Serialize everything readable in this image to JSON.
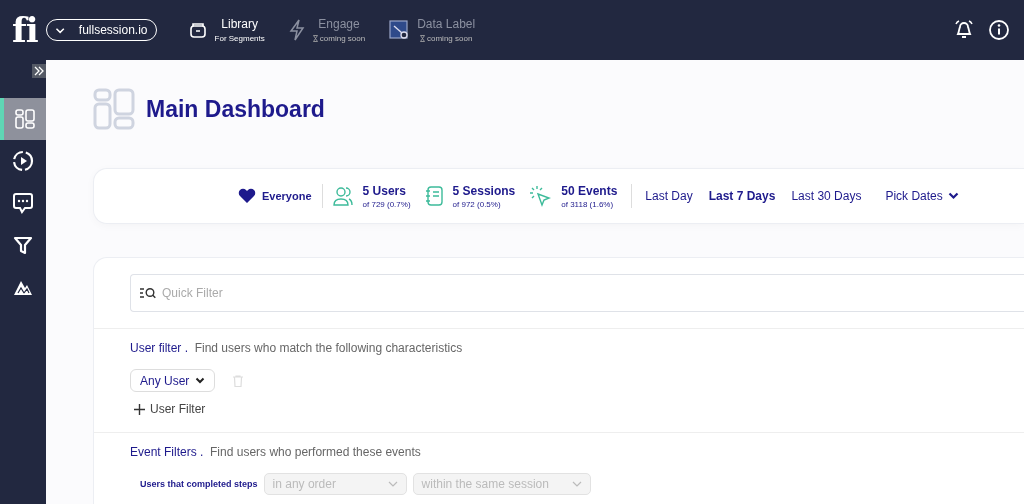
{
  "topbar": {
    "logo": "fi",
    "workspace": "fullsession.io",
    "nav": [
      {
        "kind": "library",
        "label": "Library",
        "sub": "For Segments",
        "disabled": false
      },
      {
        "kind": "engage",
        "label": "Engage",
        "sub": "coming soon",
        "disabled": true
      },
      {
        "kind": "datalabel",
        "label": "Data Label",
        "sub": "coming soon",
        "disabled": true
      }
    ]
  },
  "sidebar": {
    "items": [
      {
        "kind": "dashboard",
        "selected": true
      },
      {
        "kind": "replay",
        "selected": false
      },
      {
        "kind": "chat",
        "selected": false
      },
      {
        "kind": "funnel",
        "selected": false
      },
      {
        "kind": "mountain",
        "selected": false
      }
    ]
  },
  "page": {
    "title": "Main Dashboard"
  },
  "stats": {
    "segment": "Everyone",
    "items": [
      {
        "kind": "users",
        "value": "5 Users",
        "sub": "of 729 (0.7%)"
      },
      {
        "kind": "sessions",
        "value": "5 Sessions",
        "sub": "of 972 (0.5%)"
      },
      {
        "kind": "events",
        "value": "50 Events",
        "sub": "of 3118 (1.6%)"
      }
    ],
    "ranges": [
      {
        "label": "Last Day",
        "selected": false
      },
      {
        "label": "Last 7 Days",
        "selected": true
      },
      {
        "label": "Last 30 Days",
        "selected": false
      },
      {
        "label": "Pick Dates",
        "selected": false,
        "kind": "dropdown"
      }
    ]
  },
  "filters": {
    "quick_filter": {
      "placeholder": "Quick Filter"
    },
    "user_filter": {
      "title": "User filter .",
      "hint": "Find users who match the following characteristics",
      "select": "Any User",
      "add": "User Filter"
    },
    "event_filter": {
      "title": "Event Filters .",
      "hint": "Find users who performed these events",
      "label": "Users that completed steps",
      "order": "in any order",
      "scope": "within the same session"
    }
  }
}
